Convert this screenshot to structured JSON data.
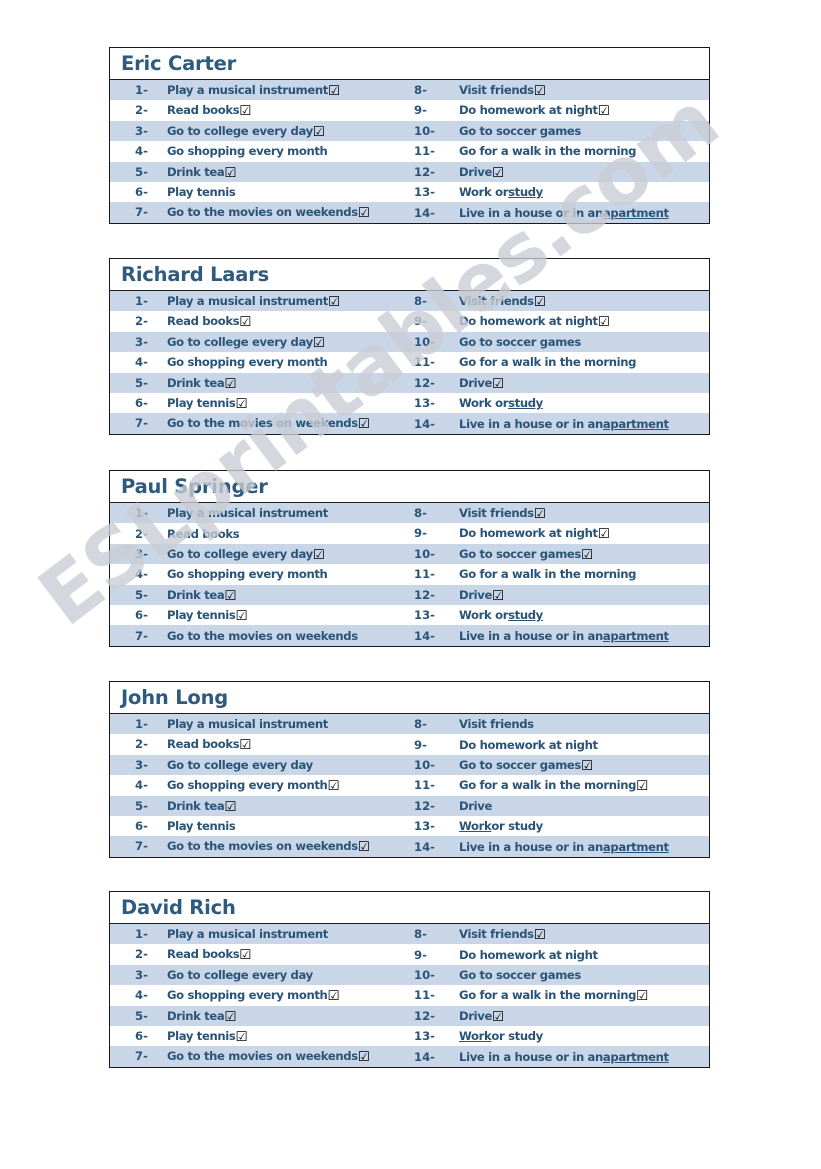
{
  "document": {
    "type": "esl-worksheet",
    "watermark": "ESLprintables.com",
    "colors": {
      "text_blue": "#2a5477",
      "header_blue": "#2e5a7d",
      "row_shade": "#c9d6e8",
      "row_plain": "#ffffff",
      "border": "#19191b",
      "watermark": "#c9cdd4"
    },
    "checkbox_glyph": "☑",
    "tasks_left": [
      {
        "num": "1-",
        "text": "Play a musical instrument"
      },
      {
        "num": "2-",
        "text": "Read books"
      },
      {
        "num": "3-",
        "text": "Go to college every day"
      },
      {
        "num": "4-",
        "text": "Go shopping  every month"
      },
      {
        "num": "5-",
        "text": "Drink tea"
      },
      {
        "num": "6-",
        "text": "Play tennis"
      },
      {
        "num": "7-",
        "text": "Go to the movies on weekends"
      }
    ],
    "tasks_right": [
      {
        "num": "8-",
        "text": "Visit friends"
      },
      {
        "num": "9-",
        "text": "Do homework at night"
      },
      {
        "num": "10-",
        "text": "Go to soccer games"
      },
      {
        "num": "11-",
        "text": "Go for a walk in the morning"
      },
      {
        "num": "12-",
        "text": "Drive"
      },
      {
        "num": "13-",
        "text": "Work or study",
        "underline_word": "study"
      },
      {
        "num": "14-",
        "text": "Live in a house or in an apartment",
        "underline_word": "apartment"
      }
    ],
    "people": [
      {
        "name": "Eric Carter",
        "checked_left": [
          true,
          true,
          true,
          false,
          true,
          false,
          true
        ],
        "checked_right": [
          true,
          true,
          false,
          false,
          true,
          false,
          false
        ],
        "underline_13": "study"
      },
      {
        "name": "Richard Laars",
        "checked_left": [
          true,
          true,
          true,
          false,
          true,
          true,
          true
        ],
        "checked_right": [
          true,
          true,
          false,
          false,
          true,
          false,
          false
        ],
        "underline_13": "study"
      },
      {
        "name": "Paul Springer",
        "checked_left": [
          false,
          false,
          true,
          false,
          true,
          true,
          false
        ],
        "checked_right": [
          true,
          true,
          true,
          false,
          true,
          false,
          false
        ],
        "underline_13": "study"
      },
      {
        "name": "John Long",
        "checked_left": [
          false,
          true,
          false,
          true,
          true,
          false,
          true
        ],
        "checked_right": [
          false,
          false,
          true,
          true,
          false,
          false,
          false
        ],
        "underline_13": "Work"
      },
      {
        "name": "David Rich",
        "checked_left": [
          false,
          true,
          false,
          true,
          true,
          true,
          true
        ],
        "checked_right": [
          true,
          false,
          false,
          true,
          true,
          false,
          false
        ],
        "underline_13": "Work"
      }
    ],
    "table_tops": [
      47,
      258,
      470,
      681,
      891
    ]
  }
}
